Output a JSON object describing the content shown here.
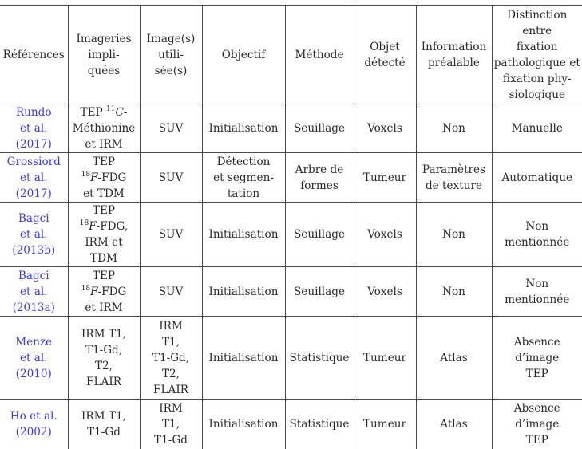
{
  "table": {
    "headers": [
      [
        "Références"
      ],
      [
        "Imageries",
        "impli-",
        "quées"
      ],
      [
        "Image(s)",
        "utili-",
        "sée(s)"
      ],
      [
        "Objectif"
      ],
      [
        "Méthode"
      ],
      [
        "Objet",
        "détecté"
      ],
      [
        "Information",
        "préalable"
      ],
      [
        "Distinction",
        "entre",
        "fixation",
        "pathologique et",
        "fixation phy-",
        "siologique"
      ]
    ],
    "rows": [
      {
        "reference": [
          "Rundo",
          "et al.",
          "(2017)"
        ],
        "imageries": {
          "l1_prefix": "TEP ",
          "l1_sup": "11",
          "l1_it": "C",
          "l1_suffix": "-",
          "l2": "Méthionine",
          "l3": "et IRM"
        },
        "images_used": [
          "SUV"
        ],
        "objective": [
          "Initialisation"
        ],
        "method": [
          "Seuillage"
        ],
        "object": [
          "Voxels"
        ],
        "prior_info": [
          "Non"
        ],
        "distinction": [
          "Manuelle"
        ]
      },
      {
        "reference": [
          "Grossiord",
          "et al.",
          "(2017)"
        ],
        "imageries": {
          "l1": "TEP",
          "l2_sup": "18",
          "l2_it": "F",
          "l2_suffix": "-FDG",
          "l3": "et TDM"
        },
        "images_used": [
          "SUV"
        ],
        "objective": [
          "Détection",
          "et segmen-",
          "tation"
        ],
        "method": [
          "Arbre de",
          "formes"
        ],
        "object": [
          "Tumeur"
        ],
        "prior_info": [
          "Paramètres",
          "de texture"
        ],
        "distinction": [
          "Automatique"
        ]
      },
      {
        "reference": [
          "Bagci",
          "et al.",
          "(2013b)"
        ],
        "imageries": {
          "l1": "TEP",
          "l2_sup": "18",
          "l2_it": "F",
          "l2_suffix": "-FDG,",
          "l3": "IRM et",
          "l4": "TDM"
        },
        "images_used": [
          "SUV"
        ],
        "objective": [
          "Initialisation"
        ],
        "method": [
          "Seuillage"
        ],
        "object": [
          "Voxels"
        ],
        "prior_info": [
          "Non"
        ],
        "distinction": [
          "Non",
          "mentionnée"
        ]
      },
      {
        "reference": [
          "Bagci",
          "et al.",
          "(2013a)"
        ],
        "imageries": {
          "l1": "TEP",
          "l2_sup": "18",
          "l2_it": "F",
          "l2_suffix": "-FDG",
          "l3": "et IRM"
        },
        "images_used": [
          "SUV"
        ],
        "objective": [
          "Initialisation"
        ],
        "method": [
          "Seuillage"
        ],
        "object": [
          "Voxels"
        ],
        "prior_info": [
          "Non"
        ],
        "distinction": [
          "Non",
          "mentionnée"
        ]
      },
      {
        "reference": [
          "Menze",
          "et al.",
          "(2010)"
        ],
        "imageries": {
          "lines": [
            "IRM T1,",
            "T1-Gd,",
            "T2,",
            "FLAIR"
          ]
        },
        "images_used": [
          "IRM",
          "T1,",
          "T1-Gd,",
          "T2,",
          "FLAIR"
        ],
        "objective": [
          "Initialisation"
        ],
        "method": [
          "Statistique"
        ],
        "object": [
          "Tumeur"
        ],
        "prior_info": [
          "Atlas"
        ],
        "distinction": [
          "Absence",
          "d’image",
          "TEP"
        ]
      },
      {
        "reference": [
          "Ho et al.",
          "(2002)"
        ],
        "imageries": {
          "lines": [
            "IRM T1,",
            "T1-Gd"
          ]
        },
        "images_used": [
          "IRM",
          "T1,",
          "T1-Gd"
        ],
        "objective": [
          "Initialisation"
        ],
        "method": [
          "Statistique"
        ],
        "object": [
          "Tumeur"
        ],
        "prior_info": [
          "Atlas"
        ],
        "distinction": [
          "Absence",
          "d’image",
          "TEP"
        ]
      }
    ]
  },
  "colors": {
    "reference_link": "#3b3be0",
    "text": "#2a2a2a",
    "rule": "#4a4a4a"
  }
}
